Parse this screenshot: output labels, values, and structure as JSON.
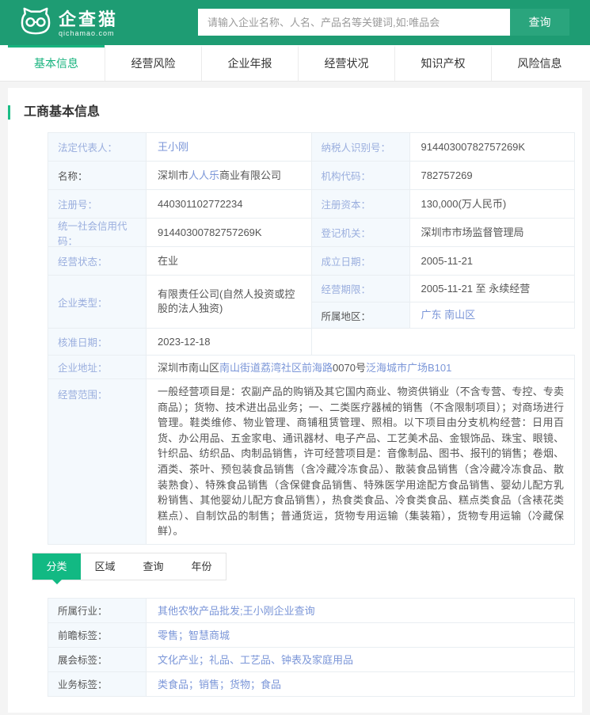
{
  "colors": {
    "header_green": "#1e9c73",
    "search_button_green": "#2aa57d",
    "accent_green": "#17b37e",
    "subtab_active_green": "#12b983",
    "label_blue": "#9aaede",
    "link_blue": "#7b96d8",
    "value_text": "#555555",
    "label_cell_bg": "#f4f9fd"
  },
  "header": {
    "logo_title": "企查猫",
    "logo_domain": "qichamao.com",
    "search_placeholder": "请输入企业名称、人名、产品名等关键词,如:唯品会",
    "search_button": "查询"
  },
  "nav_tabs": [
    {
      "label": "基本信息",
      "active": true
    },
    {
      "label": "经营风险",
      "active": false
    },
    {
      "label": "企业年报",
      "active": false
    },
    {
      "label": "经营状况",
      "active": false
    },
    {
      "label": "知识产权",
      "active": false
    },
    {
      "label": "风险信息",
      "active": false
    }
  ],
  "section_title": "工商基本信息",
  "info": {
    "left": [
      {
        "label": "法定代表人：",
        "value": "王小刚"
      },
      {
        "label": "名称：",
        "value_pre": "深圳市",
        "value_link": "人人乐",
        "value_post": "商业有限公司"
      },
      {
        "label": "注册号：",
        "value": "440301102772234"
      },
      {
        "label": "统一社会信用代码：",
        "value": "91440300782757269K"
      },
      {
        "label": "经营状态：",
        "value": "在业"
      },
      {
        "label": "企业类型：",
        "value": "有限责任公司(自然人投资或控股的法人独资)"
      },
      {
        "label": "核准日期：",
        "value": "2023-12-18"
      }
    ],
    "right": [
      {
        "label": "纳税人识别号：",
        "value": "91440300782757269K"
      },
      {
        "label": "机构代码：",
        "value": "782757269"
      },
      {
        "label": "注册资本：",
        "value": "130,000(万人民币)"
      },
      {
        "label": "登记机关：",
        "value": "深圳市市场监督管理局"
      },
      {
        "label": "成立日期：",
        "value": "2005-11-21"
      },
      {
        "label": "经营期限：",
        "value": "2005-11-21 至 永续经营"
      },
      {
        "label": "所属地区：",
        "value": "广东 南山区"
      }
    ],
    "address": {
      "label": "企业地址：",
      "part1": "深圳市南山区",
      "link1": "南山街道荔湾社区前海路",
      "part2": "0070号",
      "link2": "泛海城市广场B101"
    },
    "scope": {
      "label": "经营范围：",
      "value": "一般经营项目是：农副产品的购销及其它国内商业、物资供销业（不含专营、专控、专卖商品）；货物、技术进出品业务；一、二类医疗器械的销售（不含限制项目）；对商场进行管理。鞋类维修、物业管理、商铺租赁管理、照相。以下项目由分支机构经营：日用百货、办公用品、五金家电、通讯器材、电子产品、工艺美术品、金银饰品、珠宝、眼镜、针织品、纺织品、肉制品销售，许可经营项目是：音像制品、图书、报刊的销售；卷烟、酒类、茶叶、预包装食品销售（含冷藏冷冻食品）、散装食品销售（含冷藏冷冻食品、散装熟食）、特殊食品销售（含保健食品销售、特殊医学用途配方食品销售、婴幼儿配方乳粉销售、其他婴幼儿配方食品销售），热食类食品、冷食类食品、糕点类食品（含裱花类糕点）、自制饮品的制售；普通货运，货物专用运输（集装箱），货物专用运输（冷藏保鲜）。"
    }
  },
  "sub_tabs": [
    {
      "label": "分类",
      "active": true
    },
    {
      "label": "区域",
      "active": false
    },
    {
      "label": "查询",
      "active": false
    },
    {
      "label": "年份",
      "active": false
    }
  ],
  "tags": [
    {
      "label": "所属行业：",
      "value": "其他农牧产品批发;王小刚企业查询"
    },
    {
      "label": "前瞻标签：",
      "value": "零售；智慧商城"
    },
    {
      "label": "展会标签：",
      "value": "文化产业；礼品、工艺品、钟表及家庭用品"
    },
    {
      "label": "业务标签：",
      "value": "类食品；销售；货物；食品"
    }
  ]
}
